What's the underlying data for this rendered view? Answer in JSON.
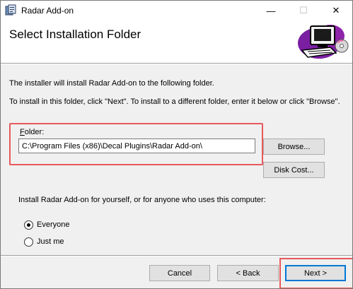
{
  "window": {
    "title": "Radar Add-on",
    "minimize_glyph": "—",
    "maximize_glyph": "☐",
    "close_glyph": "✕"
  },
  "banner": {
    "title": "Select Installation Folder",
    "art_icon": "computer-with-disc-icon"
  },
  "body": {
    "intro_text": "The installer will install Radar Add-on to the following folder.",
    "instruction_text": "To install in this folder, click \"Next\". To install to a different folder, enter it below or click \"Browse\"."
  },
  "folder": {
    "label_accel": "F",
    "label_rest": "older:",
    "value": "C:\\Program Files (x86)\\Decal Plugins\\Radar Add-on\\"
  },
  "buttons": {
    "browse": "Browse...",
    "disk_cost": "Disk Cost...",
    "cancel": "Cancel",
    "back": "< Back",
    "next": "Next >"
  },
  "install_for": {
    "prompt": "Install Radar Add-on for yourself, or for anyone who uses this computer:",
    "options": [
      {
        "label": "Everyone",
        "selected": true
      },
      {
        "label": "Just me",
        "selected": false
      }
    ]
  },
  "colors": {
    "highlight": "#e8585a",
    "default_button_border": "#0078d7"
  }
}
